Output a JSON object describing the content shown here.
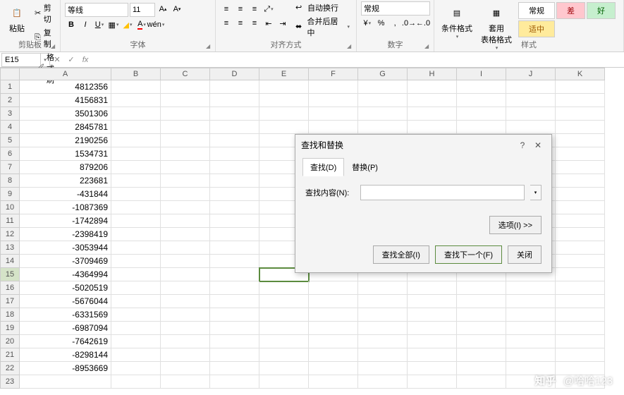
{
  "ribbon": {
    "clipboard": {
      "paste": "粘贴",
      "cut": "剪切",
      "copy": "复制",
      "format_painter": "格式刷",
      "group_label": "剪贴板"
    },
    "font": {
      "name": "等线",
      "size": "11",
      "group_label": "字体"
    },
    "alignment": {
      "wrap": "自动换行",
      "merge": "合并后居中",
      "group_label": "对齐方式"
    },
    "number": {
      "format": "常规",
      "group_label": "数字"
    },
    "styles": {
      "cond_fmt": "条件格式",
      "table_fmt": "套用\n表格格式",
      "normal": "常规",
      "bad": "差",
      "good": "好",
      "neutral": "适中",
      "group_label": "样式"
    }
  },
  "formula_bar": {
    "cell_ref": "E15",
    "fx": "fx",
    "value": ""
  },
  "columns": [
    "A",
    "B",
    "C",
    "D",
    "E",
    "F",
    "G",
    "H",
    "I",
    "J",
    "K"
  ],
  "rows": [
    {
      "n": 1,
      "a": "4812356"
    },
    {
      "n": 2,
      "a": "4156831"
    },
    {
      "n": 3,
      "a": "3501306"
    },
    {
      "n": 4,
      "a": "2845781"
    },
    {
      "n": 5,
      "a": "2190256"
    },
    {
      "n": 6,
      "a": "1534731"
    },
    {
      "n": 7,
      "a": "879206"
    },
    {
      "n": 8,
      "a": "223681"
    },
    {
      "n": 9,
      "a": "-431844"
    },
    {
      "n": 10,
      "a": "-1087369"
    },
    {
      "n": 11,
      "a": "-1742894"
    },
    {
      "n": 12,
      "a": "-2398419"
    },
    {
      "n": 13,
      "a": "-3053944"
    },
    {
      "n": 14,
      "a": "-3709469"
    },
    {
      "n": 15,
      "a": "-4364994"
    },
    {
      "n": 16,
      "a": "-5020519"
    },
    {
      "n": 17,
      "a": "-5676044"
    },
    {
      "n": 18,
      "a": "-6331569"
    },
    {
      "n": 19,
      "a": "-6987094"
    },
    {
      "n": 20,
      "a": "-7642619"
    },
    {
      "n": 21,
      "a": "-8298144"
    },
    {
      "n": 22,
      "a": "-8953669"
    },
    {
      "n": 23,
      "a": ""
    }
  ],
  "selected": {
    "row": 15,
    "col": "E"
  },
  "dialog": {
    "title": "查找和替换",
    "tab_find": "查找(D)",
    "tab_replace": "替换(P)",
    "find_label": "查找内容(N):",
    "find_value": "",
    "options": "选项(I) >>",
    "find_all": "查找全部(I)",
    "find_next": "查找下一个(F)",
    "close": "关闭"
  },
  "watermark": {
    "logo": "知乎",
    "user": "@哈哈123"
  }
}
